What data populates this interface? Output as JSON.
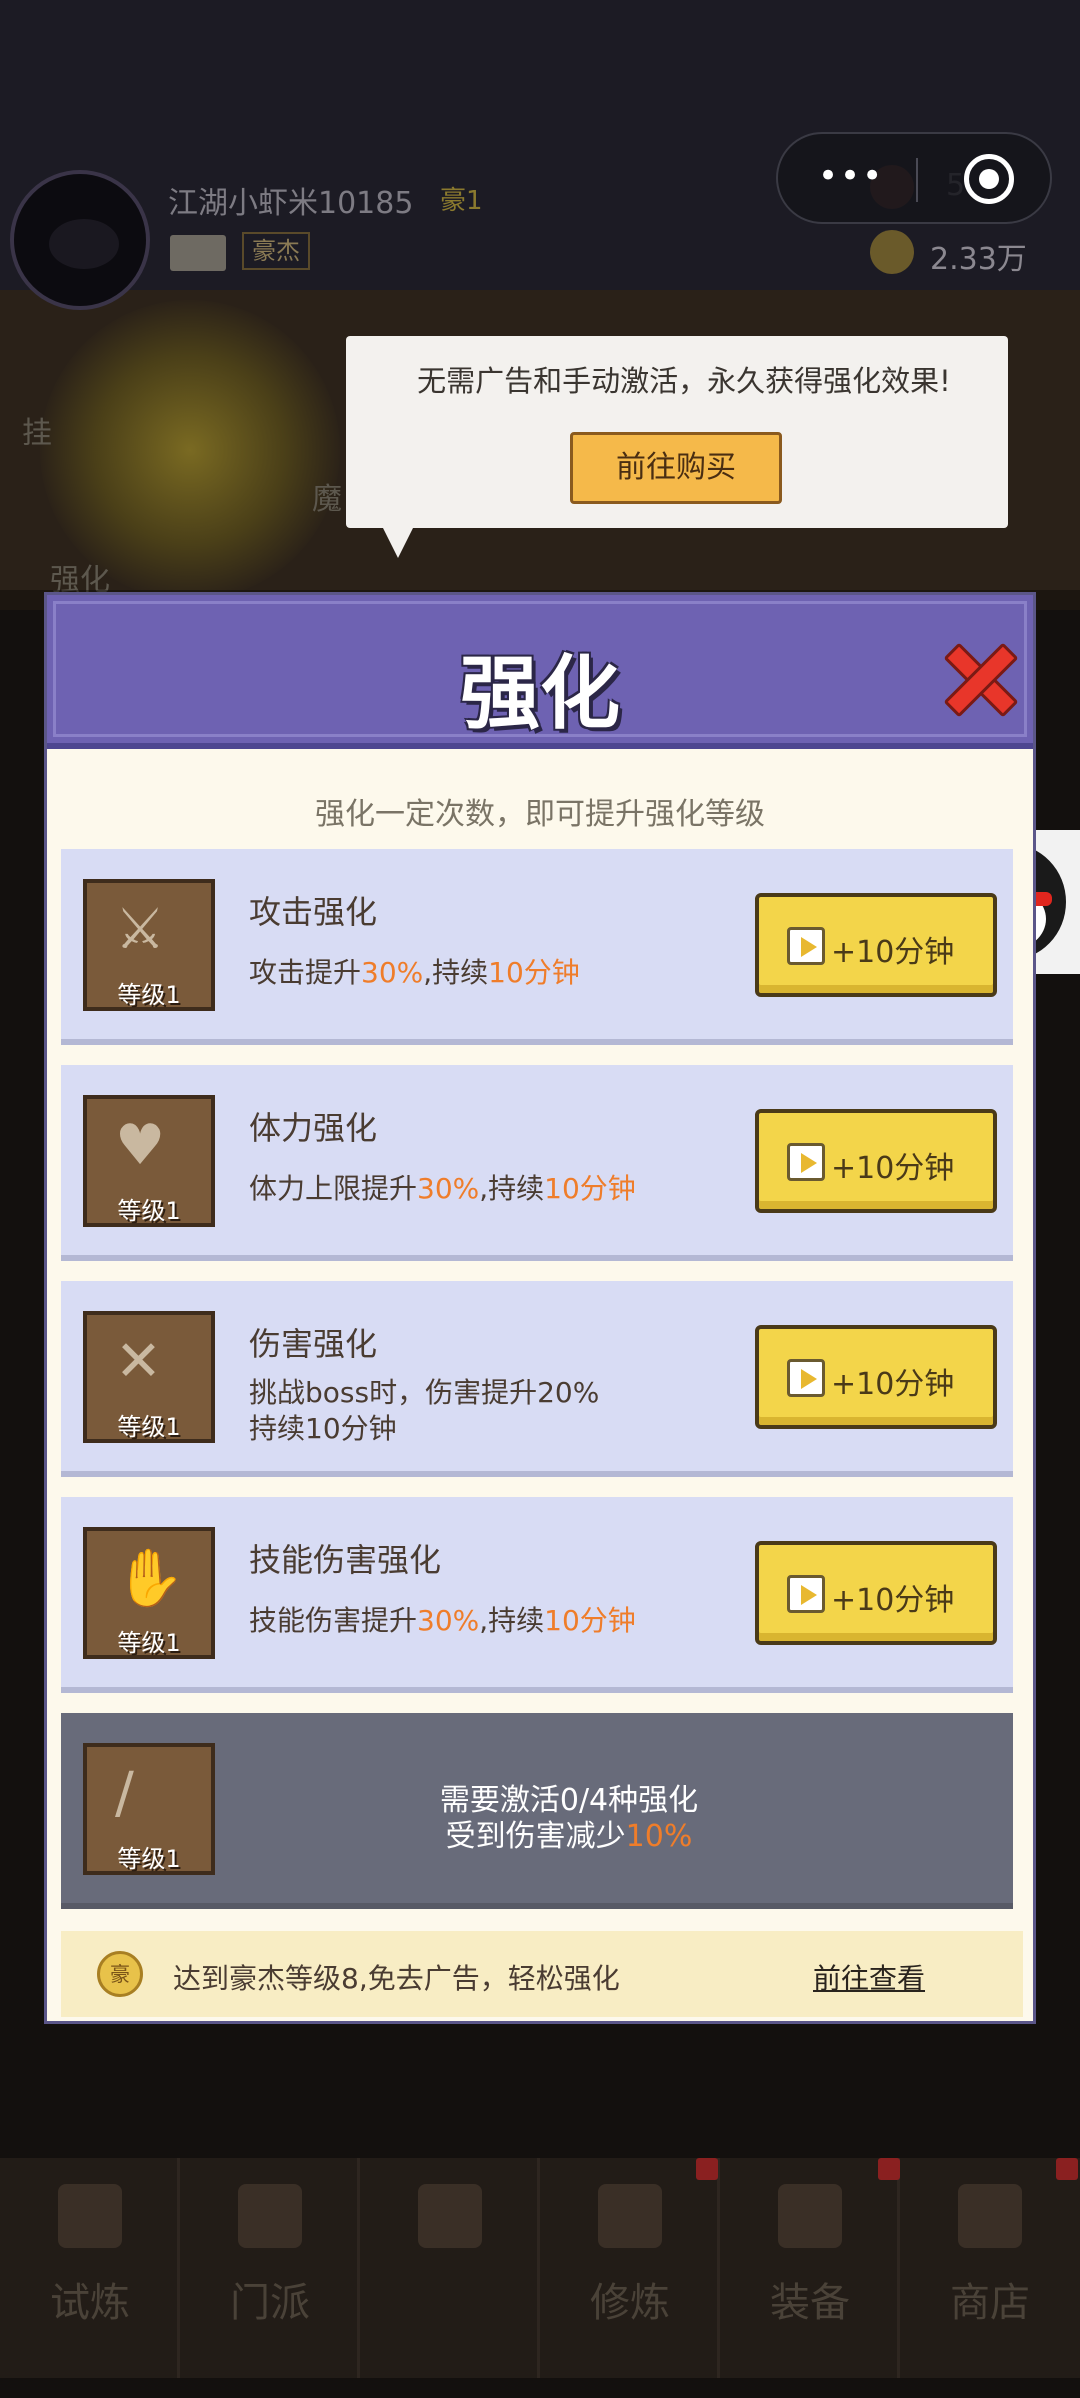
{
  "header": {
    "player_name": "江湖小虾米10185",
    "vip_label": "豪1",
    "rank_tag": "豪杰",
    "meat_value": "5",
    "coin_value": "2.33万"
  },
  "side_labels": {
    "hang": "挂",
    "strengthen": "强化",
    "demon": "魔"
  },
  "capsule": {
    "more": "•••"
  },
  "tooltip": {
    "text": "无需广告和手动激活，永久获得强化效果!",
    "buy_label": "前往购买"
  },
  "modal": {
    "title": "强化",
    "subtitle": "强化一定次数，即可提升强化等级",
    "rows": [
      {
        "title": "攻击强化",
        "level": "等级1",
        "glyph": "⚔",
        "desc_prefix": "攻击提升",
        "desc_pct": "30%",
        "desc_mid": ",持续",
        "desc_dur": "10分钟",
        "button": "+10分钟"
      },
      {
        "title": "体力强化",
        "level": "等级1",
        "glyph": "♥",
        "desc_prefix": "体力上限提升",
        "desc_pct": "30%",
        "desc_mid": ",持续",
        "desc_dur": "10分钟",
        "button": "+10分钟"
      },
      {
        "title": "伤害强化",
        "level": "等级1",
        "glyph": "✕",
        "desc_prefix": "挑战boss时，伤害提升",
        "desc_pct": "20%",
        "desc_mid": "持续",
        "desc_dur": "10分钟",
        "button": "+10分钟"
      },
      {
        "title": "技能伤害强化",
        "level": "等级1",
        "glyph": "✋",
        "desc_prefix": "技能伤害提升",
        "desc_pct": "30%",
        "desc_mid": ",持续",
        "desc_dur": "10分钟",
        "button": "+10分钟"
      }
    ],
    "locked": {
      "level": "等级1",
      "glyph": "/",
      "line1": "需要激活0/4种强化",
      "line2_prefix": "受到伤害减少",
      "line2_pct": "10%"
    },
    "footer": {
      "medal": "豪",
      "message": "达到豪杰等级8,免去广告，轻松强化",
      "link": "前往查看"
    }
  },
  "bottom_nav": [
    {
      "label": "试炼"
    },
    {
      "label": "门派"
    },
    {
      "label": ""
    },
    {
      "label": "修炼"
    },
    {
      "label": "装备"
    },
    {
      "label": "商店"
    }
  ],
  "colors": {
    "header_purple": "#6e62b2",
    "row_blue": "#d8dcf4",
    "highlight_orange": "#ef7d2a",
    "button_yellow": "#f3d54a",
    "close_red": "#e8362a"
  }
}
